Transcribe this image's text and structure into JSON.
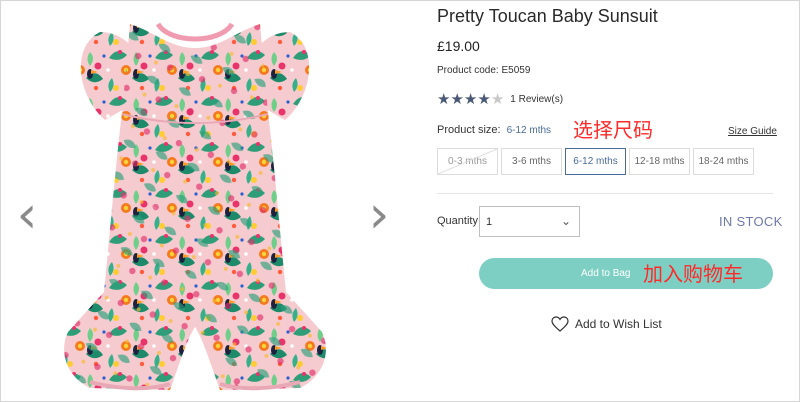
{
  "product": {
    "title": "Pretty Toucan Baby Sunsuit",
    "price": "£19.00",
    "code": "Product code: E5059",
    "rating": 4,
    "rating_max": 5,
    "reviews": "1 Review(s)"
  },
  "size": {
    "label": "Product size:",
    "selected": "6-12 mths",
    "guide": "Size Guide",
    "options": [
      {
        "label": "0-3 mths",
        "state": "unavailable"
      },
      {
        "label": "3-6 mths",
        "state": "available"
      },
      {
        "label": "6-12 mths",
        "state": "selected"
      },
      {
        "label": "12-18 mths",
        "state": "available"
      },
      {
        "label": "18-24 mths",
        "state": "available"
      }
    ]
  },
  "annotations": {
    "select_size": "选择尺码",
    "add_to_cart": "加入购物车"
  },
  "quantity": {
    "label": "Quantity",
    "value": "1"
  },
  "stock": "IN STOCK",
  "actions": {
    "add_to_bag": "Add to Bag",
    "wishlist": "Add to Wish List"
  },
  "icons": {
    "prev": "chevron-left-icon",
    "next": "chevron-right-icon",
    "star": "star-icon",
    "dropdown": "chevron-down-icon",
    "heart": "heart-icon"
  },
  "colors": {
    "accent": "#4a6b9a",
    "bag_button": "#7ecfc3",
    "stock": "#6f79a8",
    "annotation": "#ff2a2a",
    "star": "#4a5a76"
  }
}
